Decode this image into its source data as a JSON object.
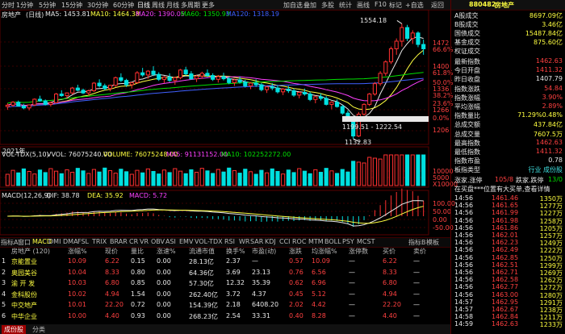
{
  "toolbar": {
    "tabs": [
      "分时",
      "1分钟",
      "5分钟",
      "15分钟",
      "30分钟",
      "60分钟",
      "日线",
      "周线",
      "月线",
      "多周期",
      "更多"
    ],
    "active_tab": "日线",
    "right_items": [
      "加自选",
      "叠加",
      "多股",
      "统计",
      "画线",
      "F10",
      "标记",
      "+自选",
      "返回"
    ]
  },
  "chart": {
    "index_name": "房地产",
    "period": "日线",
    "ma_labels": [
      "MA5: 1453.81",
      "MA10: 1464.38",
      "MA20: 1390.05",
      "MA60: 1350.93",
      "MA120: 1318.19"
    ],
    "ma_colors": [
      "#e8e8e8",
      "#ffff40",
      "#ff40ff",
      "#00e000",
      "#4060ff"
    ],
    "price_ticks": [
      "1472",
      "1400",
      "1336",
      "1266",
      "1206"
    ],
    "pct_ticks": [
      "66.6%",
      "61.8%",
      "50.0%",
      "38.2%",
      "23.6%",
      "0.0%"
    ],
    "high_label": "1554.18",
    "low_label": "1132.83",
    "range_label": "1199.51 - 1222.54",
    "date_label": "2021年",
    "vol_label": "VOL-TDX(5,10)",
    "vvol_text": "VVOL: 76075240.00",
    "volume_text": "VOLUME: 76075248.00",
    "ma5_text": "MA5: 91131152.00",
    "ma10_text": "MA10: 102252272.00",
    "vol_ticks": [
      "10000",
      "5000",
      "X10000"
    ],
    "macd_label": "MACD(12,26,9)",
    "dif_text": "DIF: 38.78",
    "dea_text": "DEA: 35.92",
    "macd_text": "MACD: 5.72",
    "macd_ticks": [
      "100.00",
      "50.00",
      "0.00",
      "-50.00"
    ],
    "day_label": "日线"
  },
  "chart_data": {
    "type": "candlestick",
    "title": "房地产",
    "ohlc": [
      [
        1250,
        1262,
        1238,
        1255
      ],
      [
        1255,
        1270,
        1249,
        1266
      ],
      [
        1266,
        1272,
        1250,
        1252
      ],
      [
        1252,
        1260,
        1240,
        1245
      ],
      [
        1245,
        1258,
        1236,
        1256
      ],
      [
        1256,
        1280,
        1252,
        1277
      ],
      [
        1277,
        1290,
        1268,
        1271
      ],
      [
        1271,
        1276,
        1254,
        1258
      ],
      [
        1258,
        1268,
        1250,
        1264
      ],
      [
        1264,
        1300,
        1262,
        1296
      ],
      [
        1296,
        1310,
        1286,
        1290
      ],
      [
        1290,
        1302,
        1278,
        1300
      ],
      [
        1300,
        1322,
        1294,
        1318
      ],
      [
        1318,
        1330,
        1306,
        1310
      ],
      [
        1310,
        1316,
        1296,
        1300
      ],
      [
        1300,
        1312,
        1290,
        1308
      ],
      [
        1308,
        1340,
        1304,
        1336
      ],
      [
        1336,
        1350,
        1320,
        1326
      ],
      [
        1326,
        1334,
        1310,
        1316
      ],
      [
        1316,
        1330,
        1306,
        1328
      ],
      [
        1328,
        1360,
        1322,
        1356
      ],
      [
        1356,
        1372,
        1340,
        1346
      ],
      [
        1346,
        1352,
        1322,
        1330
      ],
      [
        1330,
        1340,
        1316,
        1338
      ],
      [
        1338,
        1380,
        1334,
        1374
      ],
      [
        1374,
        1392,
        1360,
        1366
      ],
      [
        1366,
        1384,
        1352,
        1380
      ],
      [
        1380,
        1398,
        1362,
        1368
      ],
      [
        1368,
        1376,
        1344,
        1350
      ],
      [
        1350,
        1362,
        1336,
        1358
      ],
      [
        1358,
        1372,
        1340,
        1346
      ],
      [
        1346,
        1360,
        1330,
        1356
      ],
      [
        1356,
        1388,
        1350,
        1384
      ],
      [
        1384,
        1396,
        1364,
        1370
      ],
      [
        1370,
        1380,
        1348,
        1352
      ],
      [
        1352,
        1366,
        1340,
        1362
      ],
      [
        1362,
        1378,
        1352,
        1372
      ],
      [
        1372,
        1386,
        1358,
        1364
      ],
      [
        1364,
        1372,
        1344,
        1350
      ],
      [
        1350,
        1366,
        1338,
        1360
      ],
      [
        1360,
        1374,
        1346,
        1352
      ],
      [
        1352,
        1360,
        1332,
        1338
      ],
      [
        1338,
        1352,
        1326,
        1348
      ],
      [
        1348,
        1360,
        1334,
        1340
      ],
      [
        1340,
        1348,
        1320,
        1326
      ],
      [
        1326,
        1340,
        1314,
        1336
      ],
      [
        1336,
        1350,
        1322,
        1330
      ],
      [
        1330,
        1336,
        1306,
        1312
      ],
      [
        1312,
        1326,
        1300,
        1322
      ],
      [
        1322,
        1336,
        1310,
        1318
      ],
      [
        1318,
        1328,
        1298,
        1304
      ],
      [
        1304,
        1318,
        1292,
        1314
      ],
      [
        1314,
        1326,
        1300,
        1308
      ],
      [
        1308,
        1316,
        1286,
        1292
      ],
      [
        1292,
        1306,
        1280,
        1302
      ],
      [
        1302,
        1316,
        1290,
        1296
      ],
      [
        1296,
        1304,
        1270,
        1276
      ],
      [
        1276,
        1290,
        1262,
        1286
      ],
      [
        1286,
        1298,
        1272,
        1280
      ],
      [
        1280,
        1288,
        1254,
        1258
      ],
      [
        1258,
        1270,
        1240,
        1266
      ],
      [
        1266,
        1276,
        1246,
        1250
      ],
      [
        1250,
        1256,
        1220,
        1226
      ],
      [
        1226,
        1236,
        1199,
        1206
      ],
      [
        1206,
        1212,
        1132,
        1142
      ],
      [
        1142,
        1230,
        1138,
        1222
      ],
      [
        1222,
        1262,
        1216,
        1258
      ],
      [
        1258,
        1300,
        1252,
        1296
      ],
      [
        1296,
        1340,
        1290,
        1334
      ],
      [
        1334,
        1380,
        1326,
        1372
      ],
      [
        1372,
        1420,
        1362,
        1414
      ],
      [
        1414,
        1470,
        1406,
        1462
      ],
      [
        1462,
        1500,
        1440,
        1490
      ],
      [
        1490,
        1554,
        1470,
        1540
      ],
      [
        1540,
        1550,
        1490,
        1500
      ],
      [
        1500,
        1530,
        1480,
        1520
      ],
      [
        1520,
        1526,
        1468,
        1478
      ],
      [
        1478,
        1496,
        1440,
        1462
      ]
    ],
    "ylim": [
      1120,
      1570
    ],
    "ma_series": [
      "MA5",
      "MA10",
      "MA20",
      "MA60",
      "MA120"
    ]
  },
  "indicators": {
    "left_labels": [
      "指标A",
      "窗口"
    ],
    "tabs": [
      "MACD",
      "DMI",
      "DMA",
      "FSL",
      "TRIX",
      "BRAR",
      "CR",
      "VR",
      "OBV",
      "ASI",
      "EMV",
      "VOL-TDX",
      "RSI",
      "WR",
      "SAR",
      "KDJ",
      "CCI",
      "ROC",
      "MTM",
      "BOLL",
      "PSY",
      "MCST"
    ],
    "active": "MACD",
    "right_labels": [
      "指标B",
      "模板"
    ]
  },
  "table": {
    "headers": [
      "",
      "房地产 (120)",
      "涨幅%",
      "现价",
      "量比",
      "涨速%",
      "流通市值",
      "换手%",
      "市盈(动)",
      "涨跌",
      "均涨幅%",
      "涨停数",
      "买价",
      "卖价"
    ],
    "rows": [
      {
        "no": "1",
        "name": "京能置业",
        "pct": "10.09",
        "price": "6.22",
        "vr": "0.15",
        "speed": "0.00",
        "mcap": "28.13亿",
        "turn": "2.37",
        "pe": "—",
        "chg": "0.57",
        "avg": "10.09",
        "lim": "—",
        "bid": "6.22",
        "ask": "—"
      },
      {
        "no": "2",
        "name": "奥园美谷",
        "pct": "10.04",
        "price": "8.33",
        "vr": "0.80",
        "speed": "0.00",
        "mcap": "64.36亿",
        "turn": "3.69",
        "pe": "23.13",
        "chg": "0.76",
        "avg": "6.56",
        "lim": "—",
        "bid": "8.33",
        "ask": "—"
      },
      {
        "no": "3",
        "name": "渝 开 发",
        "pct": "10.03",
        "price": "6.80",
        "vr": "0.85",
        "speed": "0.00",
        "mcap": "57.30亿",
        "turn": "12.32",
        "pe": "35.39",
        "chg": "0.62",
        "avg": "6.96",
        "lim": "—",
        "bid": "6.80",
        "ask": "—"
      },
      {
        "no": "4",
        "name": "金科股份",
        "pct": "10.02",
        "price": "4.94",
        "vr": "1.54",
        "speed": "0.00",
        "mcap": "262.40亿",
        "turn": "3.72",
        "pe": "4.37",
        "chg": "0.45",
        "avg": "5.12",
        "lim": "—",
        "bid": "4.94",
        "ask": "—"
      },
      {
        "no": "5",
        "name": "中交地产",
        "pct": "10.01",
        "price": "22.20",
        "vr": "0.72",
        "speed": "0.00",
        "mcap": "154.39亿",
        "turn": "2.18",
        "pe": "6408.20",
        "chg": "2.02",
        "avg": "4.42",
        "lim": "—",
        "bid": "22.20",
        "ask": "—"
      },
      {
        "no": "6",
        "name": "中华企业",
        "pct": "10.00",
        "price": "4.40",
        "vr": "0.93",
        "speed": "0.00",
        "mcap": "268.23亿",
        "turn": "2.54",
        "pe": "33.31",
        "chg": "0.40",
        "avg": "8.28",
        "lim": "—",
        "bid": "4.40",
        "ask": "—"
      }
    ]
  },
  "bottom": {
    "left": "成份股",
    "tab2": "分类"
  },
  "right_panel": {
    "code": "880482",
    "name": "房地产",
    "summary": [
      {
        "k": "A股成交",
        "v": "8697.09亿",
        "c": "yel"
      },
      {
        "k": "B股成交",
        "v": "3.46亿",
        "c": "yel"
      },
      {
        "k": "国债成交",
        "v": "15487.84亿",
        "c": "yel"
      },
      {
        "k": "基金成交",
        "v": "875.60亿",
        "c": "yel"
      },
      {
        "k": "权证成交",
        "v": "",
        "c": "yel"
      }
    ],
    "stats": [
      {
        "k": "最新指数",
        "v": "1462.63",
        "c": "red"
      },
      {
        "k": "今日开盘",
        "v": "1411.32",
        "c": "red"
      },
      {
        "k": "昨日收盘",
        "v": "1407.79",
        "c": "wht"
      },
      {
        "k": "指数涨跌",
        "v": "54.84",
        "c": "red"
      },
      {
        "k": "指数涨幅",
        "v": "3.90%",
        "c": "red"
      },
      {
        "k": "平均涨幅",
        "v": "2.89%",
        "c": "red"
      },
      {
        "k": "指数量比",
        "v": "71.29%0.48%",
        "c": "yel"
      },
      {
        "k": "总成交额",
        "v": "437.84亿",
        "c": "yel"
      },
      {
        "k": "总成交量",
        "v": "7607.5万",
        "c": "yel"
      },
      {
        "k": "最高指数",
        "v": "1462.63",
        "c": "red"
      },
      {
        "k": "最低指数",
        "v": "1411.32",
        "c": "red"
      },
      {
        "k": "指数市盈",
        "v": "0.78",
        "c": "wht"
      },
      {
        "k": "板指类型",
        "v": "行业 成份股",
        "c": "cyan"
      }
    ],
    "updown": {
      "label": "涨家.涨停",
      "a": "105/8",
      "label2": "跌家.跌停",
      "b": "13/0"
    },
    "notice": "在买盘***位置有大买单,查看详情",
    "ticks": [
      {
        "t": "14:56",
        "p": "1461.46",
        "v": "1350万"
      },
      {
        "t": "14:56",
        "p": "1461.65",
        "v": "1277万"
      },
      {
        "t": "14:56",
        "p": "1461.99",
        "v": "1227万"
      },
      {
        "t": "14:56",
        "p": "1461.98",
        "v": "1258万"
      },
      {
        "t": "14:56",
        "p": "1461.86",
        "v": "1205万"
      },
      {
        "t": "14:56",
        "p": "1462.01",
        "v": "1257万"
      },
      {
        "t": "14:56",
        "p": "1462.23",
        "v": "1249万"
      },
      {
        "t": "14:56",
        "p": "1462.49",
        "v": "1222万"
      },
      {
        "t": "14:56",
        "p": "1462.85",
        "v": "1250万"
      },
      {
        "t": "14:56",
        "p": "1462.51",
        "v": "1299万"
      },
      {
        "t": "14:56",
        "p": "1462.71",
        "v": "1269万"
      },
      {
        "t": "14:56",
        "p": "1462.58",
        "v": "1262万"
      },
      {
        "t": "14:56",
        "p": "1462.77",
        "v": "1272万"
      },
      {
        "t": "14:56",
        "p": "1463.00",
        "v": "1280万"
      },
      {
        "t": "14:57",
        "p": "1462.95",
        "v": "1291万"
      },
      {
        "t": "14:57",
        "p": "1462.67",
        "v": "1238万"
      },
      {
        "t": "14:58",
        "p": "1462.84",
        "v": "1211万"
      },
      {
        "t": "14:59",
        "p": "1462.63",
        "v": "1233万"
      },
      {
        "t": "15:00",
        "p": "1462.63",
        "v": "1237万"
      }
    ]
  }
}
